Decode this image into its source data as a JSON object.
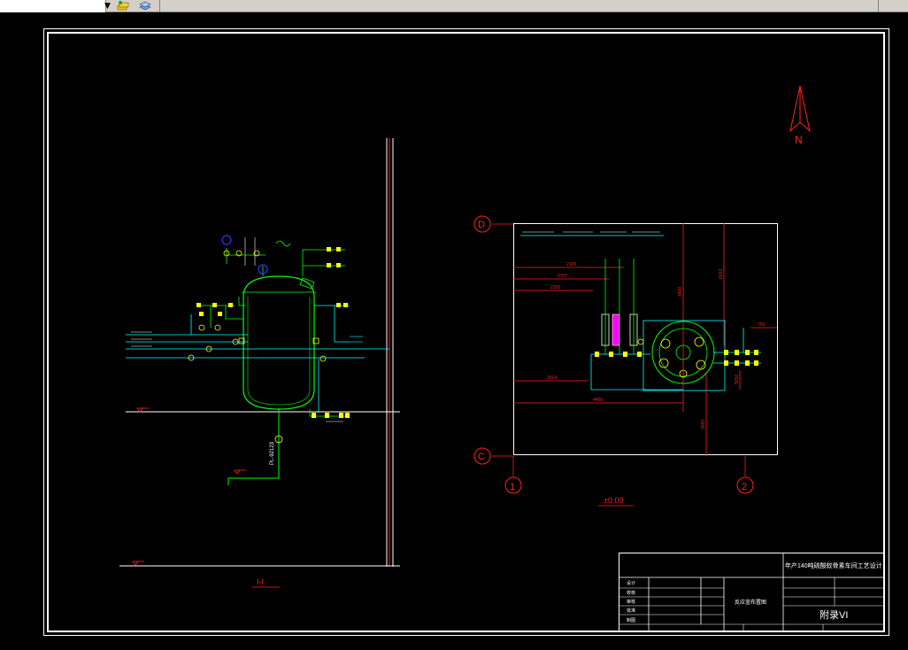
{
  "toolbar": {
    "layer_dropdown_value": "",
    "icons": [
      "layer-states-icon",
      "layer-stack-icon"
    ]
  },
  "drawing": {
    "section_label": "I-I",
    "elevation_label": "±0.00",
    "north_label": "N",
    "grid_labels": {
      "row_d": "D",
      "row_c": "C",
      "col_1": "1",
      "col_2": "2"
    },
    "dimensions": [
      "2100",
      "2707",
      "2320",
      "3400",
      "2014",
      "4400",
      "6012",
      "3020",
      "5016",
      "750"
    ],
    "pipe_label": "PL-92123"
  },
  "title_block": {
    "project_title": "年产140吨硫酸软骨素车间工艺设计",
    "drawing_name": "反应釜布置图",
    "appendix": "附录VI",
    "left_labels": [
      "设计",
      "校核",
      "审核",
      "批准",
      "制图"
    ]
  },
  "colors": {
    "frame": "#ffffff",
    "pipe": "#00ff00",
    "dimension": "#ff0000",
    "utility": "#00ffff",
    "valve": "#ffff00",
    "marker": "#0000ff"
  }
}
